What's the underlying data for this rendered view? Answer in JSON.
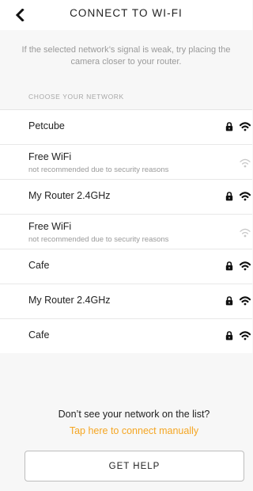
{
  "header": {
    "title": "CONNECT TO WI-FI",
    "back_icon": "chevron-left-icon"
  },
  "hint": "If the selected network’s signal is weak, try placing the camera closer to your router.",
  "section_label": "CHOOSE YOUR NETWORK",
  "networks": [
    {
      "name": "Petcube",
      "sub": "",
      "locked": true,
      "recommended": true
    },
    {
      "name": "Free WiFi",
      "sub": "not recommended due to security reasons",
      "locked": false,
      "recommended": false
    },
    {
      "name": "My Router 2.4GHz",
      "sub": "",
      "locked": true,
      "recommended": true
    },
    {
      "name": "Free WiFi",
      "sub": "not recommended due to security reasons",
      "locked": false,
      "recommended": false
    },
    {
      "name": "Cafe",
      "sub": "",
      "locked": true,
      "recommended": true
    },
    {
      "name": "My Router 2.4GHz",
      "sub": "",
      "locked": true,
      "recommended": true
    },
    {
      "name": "Cafe",
      "sub": "",
      "locked": true,
      "recommended": true
    }
  ],
  "footer": {
    "question": "Don’t see your network on the list?",
    "manual_link": "Tap here to connect manually",
    "help_button": "GET HELP"
  },
  "colors": {
    "accent": "#f5a623",
    "weak_signal": "#c8c8c8",
    "strong_signal": "#111111"
  }
}
